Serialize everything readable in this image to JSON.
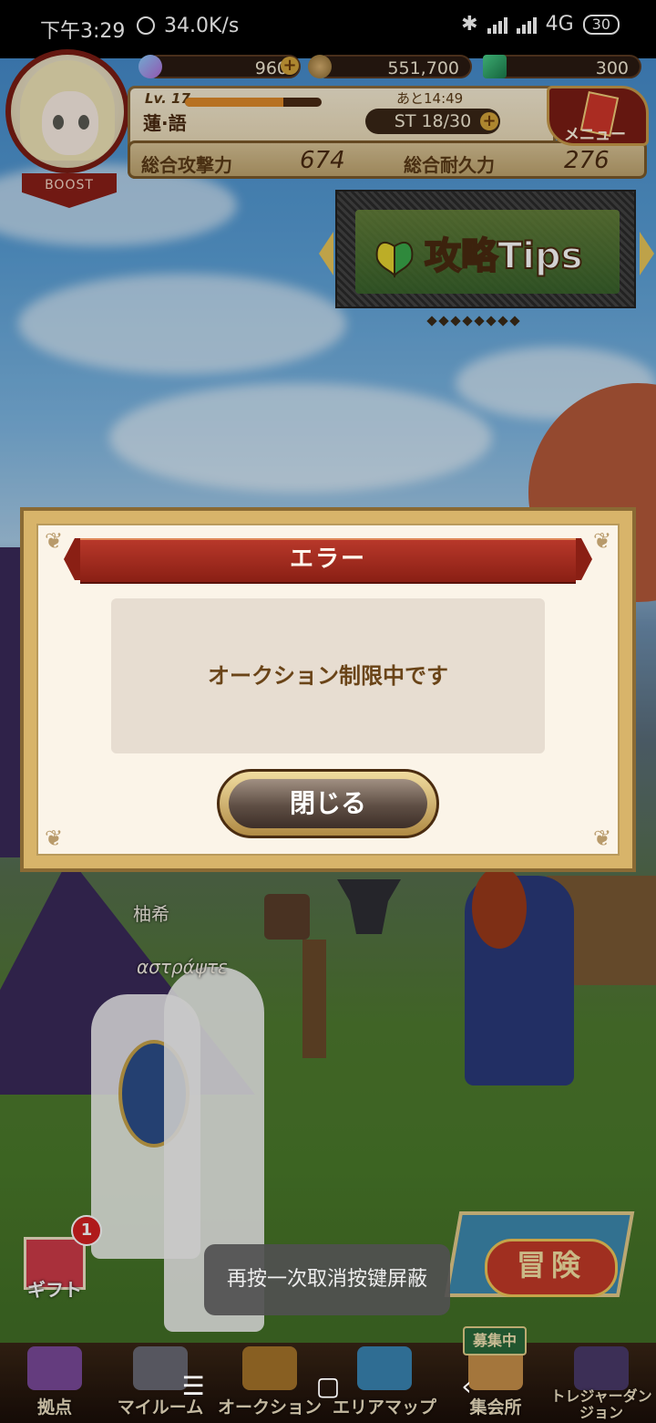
{
  "status_bar": {
    "time": "下午3:29",
    "net_speed": "34.0K/s",
    "network": "4G",
    "battery": "30"
  },
  "hud": {
    "gems": "960",
    "gold": "551,700",
    "crystals": "300",
    "level": "Lv. 17",
    "level_progress": 0.72,
    "player_name": "蓮·語",
    "stamina_timer": "あと14:49",
    "stamina": "ST 18/30",
    "attack_label": "総合攻撃力",
    "attack_value": "674",
    "defense_label": "総合耐久力",
    "defense_value": "276",
    "menu_label": "メニュー",
    "boost_label": "BOOST"
  },
  "tips": {
    "label": "攻略Tips",
    "page_count": 8
  },
  "scene": {
    "name_tag_1": "柚希",
    "name_tag_2": "αστράψτε"
  },
  "dialog": {
    "title": "エラー",
    "message": "オークション制限中です",
    "close_label": "閉じる"
  },
  "gift": {
    "label": "ギフト",
    "badge": "1"
  },
  "adventure": {
    "label": "冒険"
  },
  "toast": {
    "text": "再按一次取消按键屏蔽"
  },
  "bottom_nav": {
    "recruit_badge": "募集中",
    "items": [
      {
        "label": "拠点"
      },
      {
        "label": "マイルーム"
      },
      {
        "label": "オークション"
      },
      {
        "label": "エリアマップ"
      },
      {
        "label": "集会所"
      },
      {
        "label": "トレジャーダンジョン"
      }
    ]
  },
  "colors": {
    "dialog_title_bg": "#8a1f14",
    "dialog_text": "#6a4418",
    "accent_gold": "#d8b46a"
  }
}
